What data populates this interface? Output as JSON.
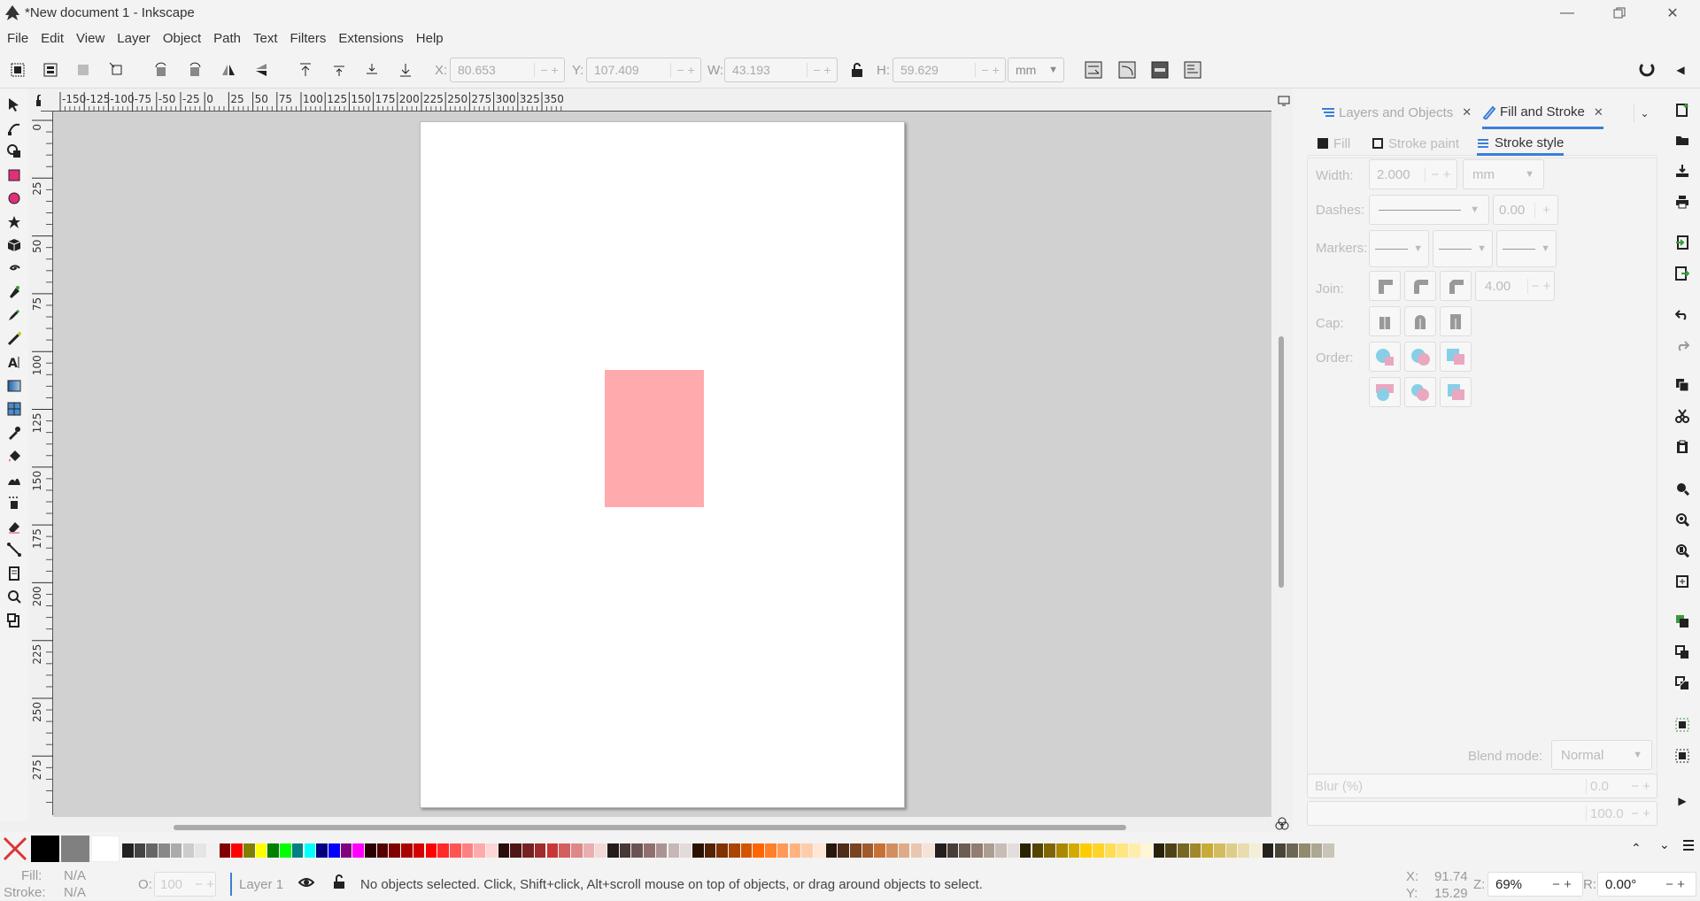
{
  "window": {
    "title": "*New document 1 - Inkscape"
  },
  "menu": [
    "File",
    "Edit",
    "View",
    "Layer",
    "Object",
    "Path",
    "Text",
    "Filters",
    "Extensions",
    "Help"
  ],
  "toolbar": {
    "x_label": "X:",
    "x_value": "80.653",
    "y_label": "Y:",
    "y_value": "107.409",
    "w_label": "W:",
    "w_value": "43.193",
    "h_label": "H:",
    "h_value": "59.629",
    "unit": "mm"
  },
  "ruler": {
    "h_ticks": [
      "-150",
      "-125",
      "-100",
      "-75",
      "-50",
      "-25",
      "0",
      "25",
      "50",
      "75",
      "100",
      "125",
      "150",
      "175",
      "200",
      "225",
      "250",
      "275",
      "300",
      "325",
      "350"
    ],
    "v_ticks": [
      "0",
      "25",
      "50",
      "75",
      "100",
      "125",
      "150",
      "175",
      "200",
      "225",
      "250",
      "275"
    ]
  },
  "docks": {
    "tab1": "Layers and Objects",
    "tab2": "Fill and Stroke"
  },
  "fillstroke": {
    "fill_tab": "Fill",
    "stroke_paint_tab": "Stroke paint",
    "stroke_style_tab": "Stroke style",
    "width_label": "Width:",
    "width_value": "2.000",
    "width_unit": "mm",
    "dashes_label": "Dashes:",
    "dashes_value": "0.00",
    "markers_label": "Markers:",
    "join_label": "Join:",
    "miter_value": "4.00",
    "cap_label": "Cap:",
    "order_label": "Order:",
    "blend_label": "Blend mode:",
    "blend_value": "Normal",
    "blur_label": "Blur (%)",
    "blur_value": "0.0",
    "opacity_value": "100.0"
  },
  "status": {
    "fill_label": "Fill:",
    "fill_value": "N/A",
    "stroke_label": "Stroke:",
    "stroke_value": "N/A",
    "o_label": "O:",
    "o_value": "100",
    "layer": "Layer 1",
    "message": "No objects selected. Click, Shift+click, Alt+scroll mouse on top of objects, or drag around objects to select.",
    "cx_label": "X:",
    "cx_value": "91.74",
    "cy_label": "Y:",
    "cy_value": "15.29",
    "zoom_label": "Z:",
    "zoom_value": "69%",
    "rot_label": "R:",
    "rot_value": "0.00°"
  },
  "colors": {
    "rect_fill": "#ffaaac",
    "accent": "#3b7fd9",
    "palette": [
      "#000000",
      "#808080",
      "#ffffff",
      "#222222",
      "#444444",
      "#666666",
      "#888888",
      "#aaaaaa",
      "#cccccc",
      "#e5e5e5",
      "#f2f2f2",
      "#800000",
      "#ff0000",
      "#808000",
      "#ffff00",
      "#008000",
      "#00ff00",
      "#008080",
      "#00ffff",
      "#000080",
      "#0000ff",
      "#800080",
      "#ff00ff",
      "#2b0000",
      "#550000",
      "#800000",
      "#aa0000",
      "#d40000",
      "#ff0000",
      "#ff2a2a",
      "#ff5555",
      "#ff8080",
      "#ffaaaa",
      "#ffd5d5",
      "#280b0b",
      "#501616",
      "#782121",
      "#a02c2c",
      "#c83737",
      "#d35f5f",
      "#de8787",
      "#e9afaf",
      "#f4d7d7",
      "#241c1c",
      "#483737",
      "#6c5353",
      "#916f6f",
      "#ac9393",
      "#c8b7b7",
      "#e3dbdb",
      "#2b1100",
      "#552200",
      "#803300",
      "#aa4400",
      "#d45500",
      "#ff6600",
      "#ff7f2a",
      "#ff9955",
      "#ffb380",
      "#ffccaa",
      "#ffe6d5",
      "#28170b",
      "#502d16",
      "#784421",
      "#a05a2c",
      "#c87137",
      "#d38d5f",
      "#deaa87",
      "#e9c6af",
      "#f4e3d7",
      "#241f1c",
      "#483e37",
      "#6c5d53",
      "#917c6f",
      "#ac9d93",
      "#c8beb7",
      "#e3dedb",
      "#2b2200",
      "#554400",
      "#806600",
      "#aa8800",
      "#d4aa00",
      "#ffcc00",
      "#ffd42a",
      "#ffdd55",
      "#ffe680",
      "#ffeeaa",
      "#fff6d5",
      "#28220b",
      "#504416",
      "#786721",
      "#a0892c",
      "#c8ab37",
      "#d3bc5f",
      "#decd87",
      "#e9ddaf",
      "#f4eed7",
      "#24221c",
      "#484537",
      "#6c6753",
      "#918a6f",
      "#aca793",
      "#c8c4b7"
    ]
  }
}
